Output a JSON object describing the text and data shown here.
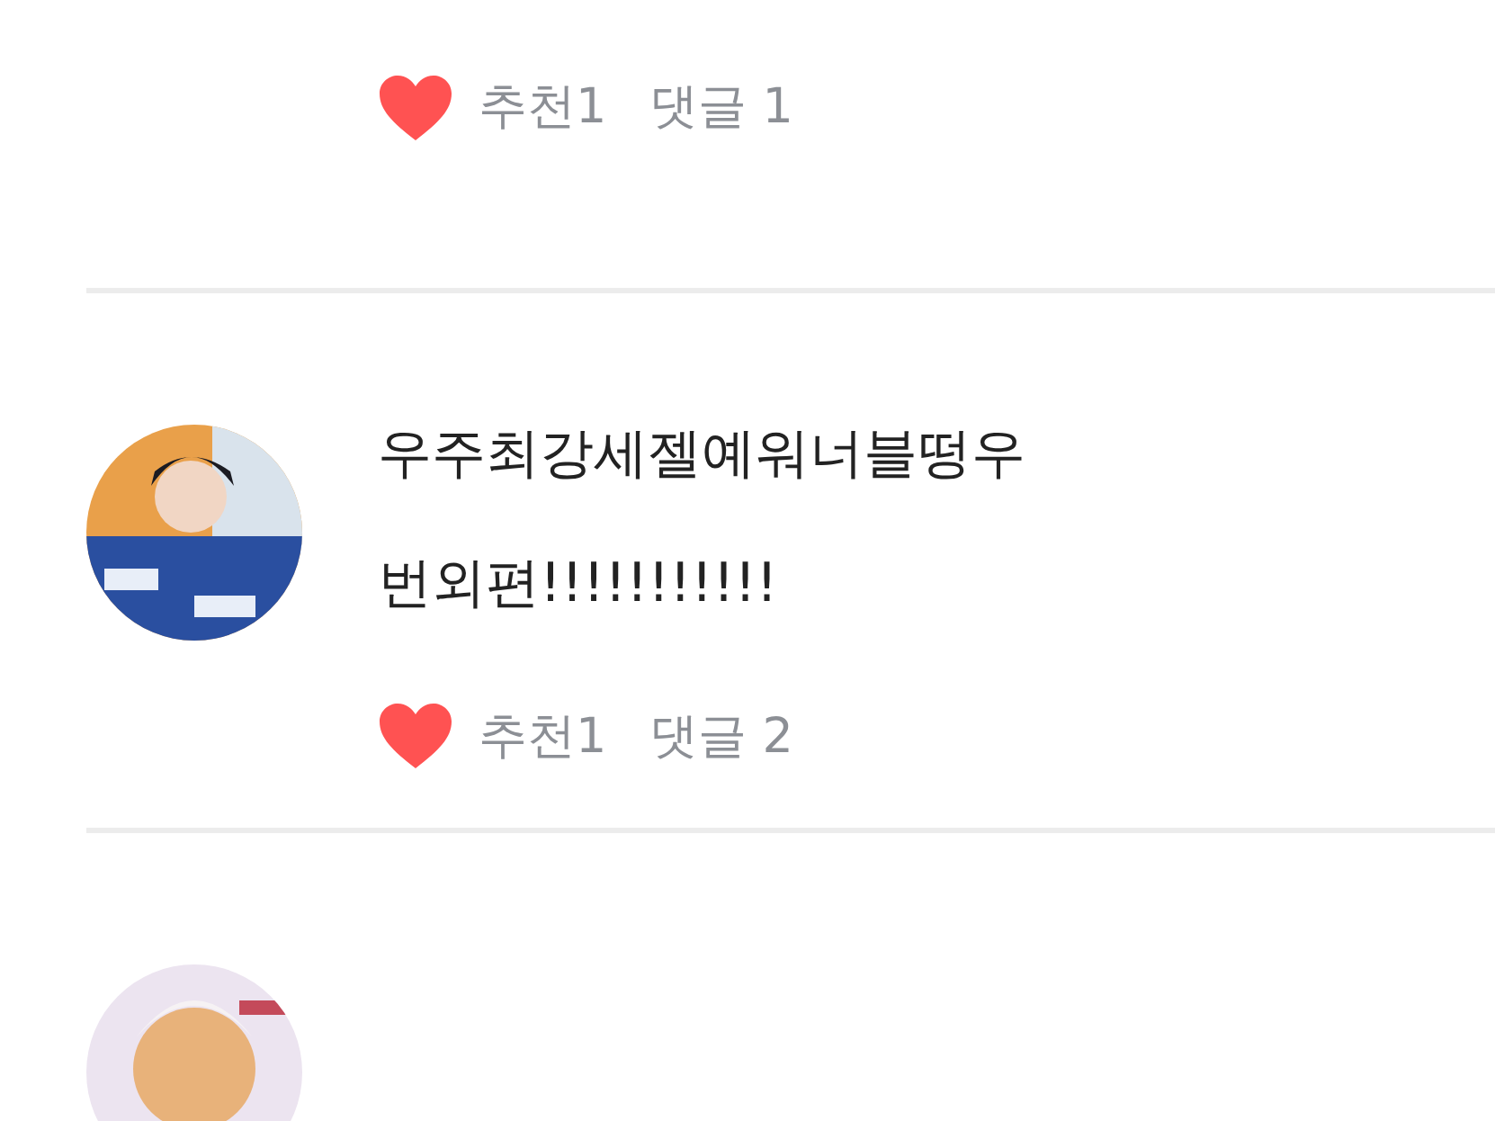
{
  "posts": [
    {
      "kind": "continued",
      "likes_label": "추천1",
      "comments_label": "댓글 1"
    },
    {
      "kind": "full",
      "text_lines": [
        "우주최강세젤예워너블떵우",
        "번외편!!!!!!!!!!!"
      ],
      "likes_label": "추천1",
      "comments_label": "댓글 2"
    },
    {
      "kind": "avatar_only"
    }
  ]
}
